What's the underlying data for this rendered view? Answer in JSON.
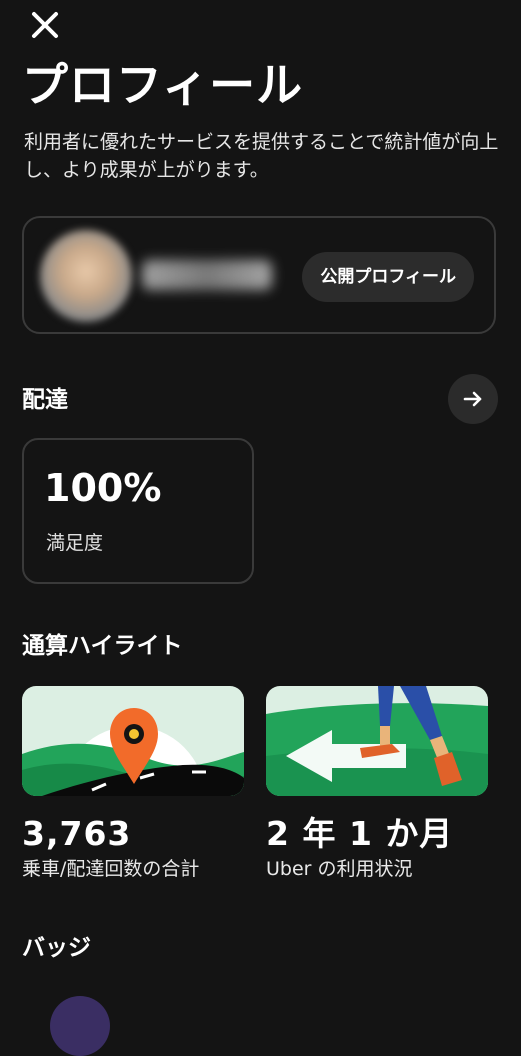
{
  "header": {
    "close_icon": "close-icon",
    "title": "プロフィール",
    "description": "利用者に優れたサービスを提供することで統計値が向上し、より成果が上がります。"
  },
  "profile_card": {
    "public_profile_label": "公開プロフィール"
  },
  "delivery": {
    "heading": "配達",
    "arrow_icon": "arrow-right-icon",
    "stat": {
      "value": "100%",
      "label": "満足度"
    }
  },
  "highlights": {
    "heading": "通算ハイライト",
    "items": [
      {
        "value": "3,763",
        "label": "乗車/配達回数の合計",
        "image": "map-pin-road-illustration"
      },
      {
        "value": "2 年 1 か月",
        "label": "Uber の利用状況",
        "image": "walking-arrow-illustration"
      }
    ]
  },
  "badges": {
    "heading": "バッジ"
  },
  "colors": {
    "background": "#141414",
    "card_border": "#3a3a3a",
    "button_bg": "#2c2c2c",
    "accent_green": "#1fa45a",
    "accent_orange": "#f26b2a"
  }
}
